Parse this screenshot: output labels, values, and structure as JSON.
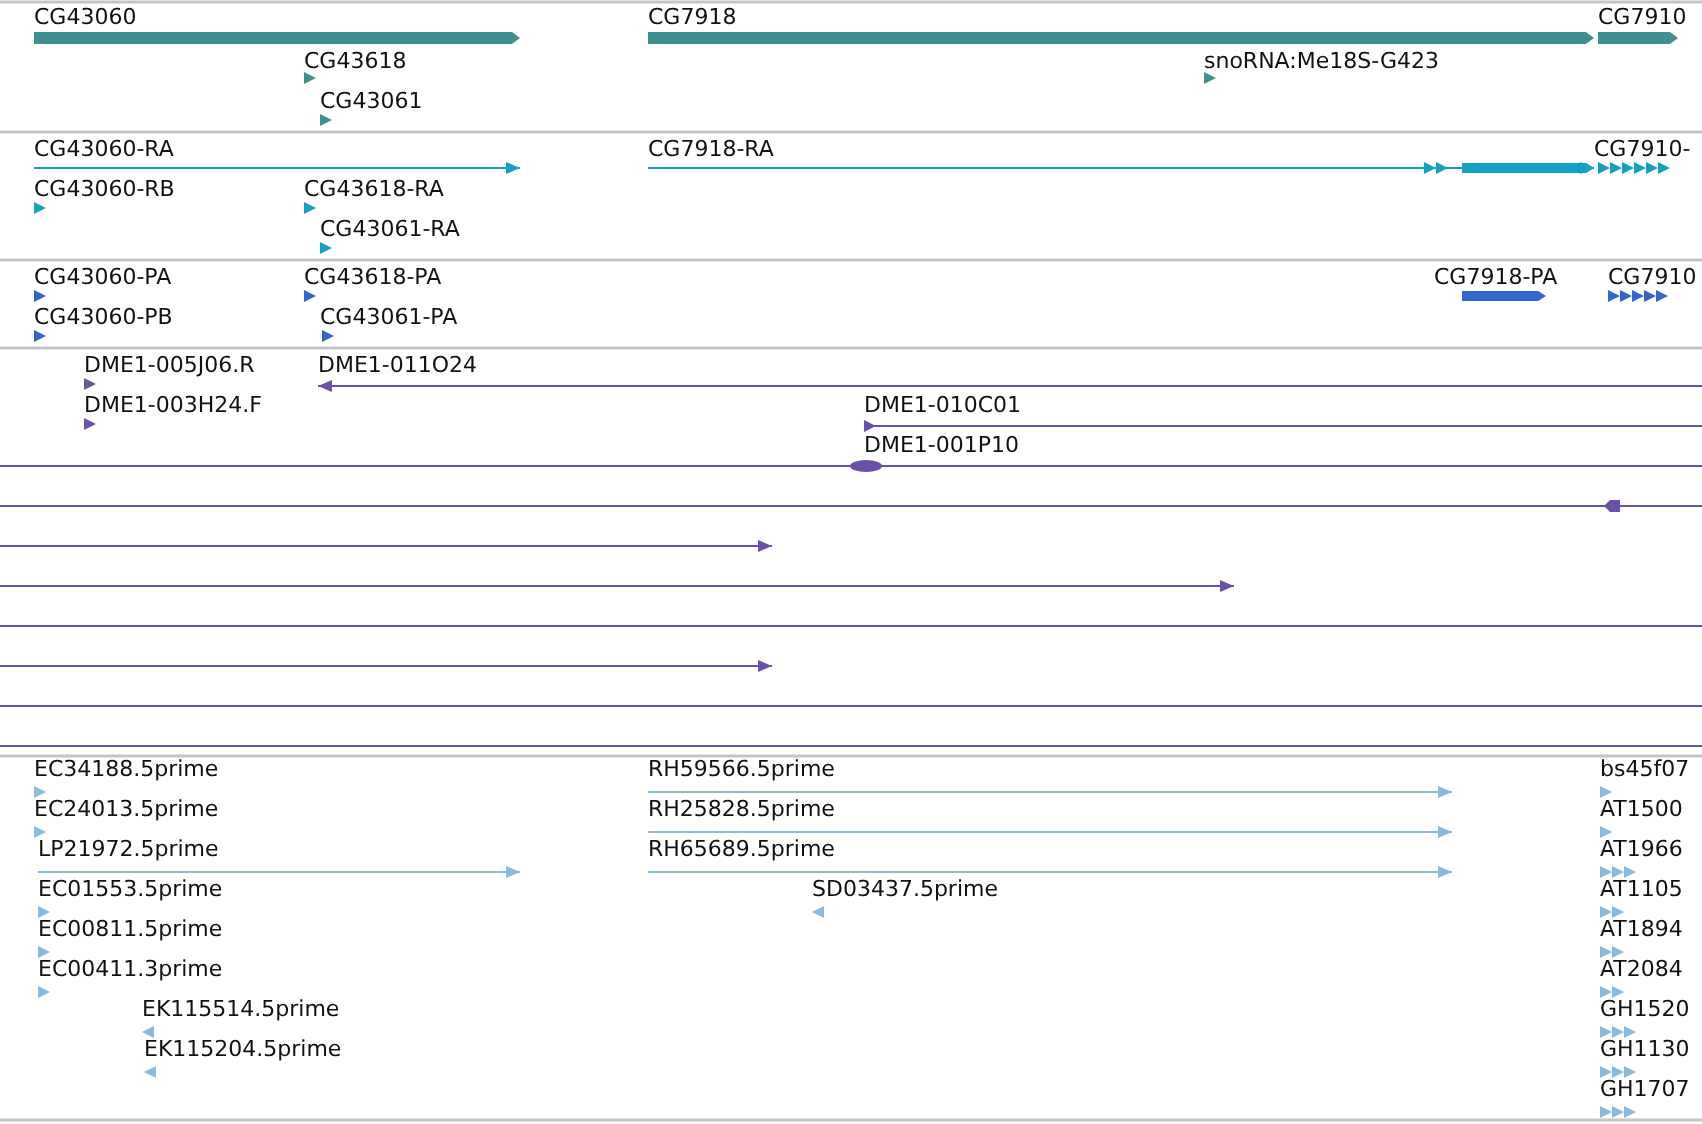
{
  "tracks": [
    {
      "color": "#3f9090",
      "features": [
        {
          "label": "CG43060",
          "kind": "block",
          "reverse": false
        },
        {
          "label": "CG43618",
          "kind": "arrow",
          "reverse": false
        },
        {
          "label": "CG43061",
          "kind": "arrow",
          "reverse": false
        },
        {
          "label": "CG7918",
          "kind": "block",
          "reverse": false
        },
        {
          "label": "snoRNA:Me18S-G423",
          "kind": "arrow",
          "reverse": false
        },
        {
          "label": "CG7910",
          "kind": "block",
          "reverse": false
        }
      ]
    },
    {
      "color": "#14a0c0",
      "features": [
        {
          "label": "CG43060-RA",
          "kind": "line",
          "reverse": false
        },
        {
          "label": "CG43060-RB",
          "kind": "arrow",
          "reverse": false
        },
        {
          "label": "CG43618-RA",
          "kind": "arrow",
          "reverse": false
        },
        {
          "label": "CG43061-RA",
          "kind": "arrow",
          "reverse": false
        },
        {
          "label": "CG7918-RA",
          "kind": "line",
          "reverse": false
        },
        {
          "label": "CG7910-",
          "kind": "arrow",
          "reverse": false
        }
      ]
    },
    {
      "color": "#3366cc",
      "features": [
        {
          "label": "CG43060-PA",
          "kind": "arrow",
          "reverse": false
        },
        {
          "label": "CG43060-PB",
          "kind": "arrow",
          "reverse": false
        },
        {
          "label": "CG43618-PA",
          "kind": "arrow",
          "reverse": false
        },
        {
          "label": "CG43061-PA",
          "kind": "arrow",
          "reverse": false
        },
        {
          "label": "CG7918-PA",
          "kind": "block",
          "reverse": false
        },
        {
          "label": "CG7910",
          "kind": "arrow",
          "reverse": false
        }
      ]
    },
    {
      "color": "#6a50aa",
      "features": [
        {
          "label": "DME1-005J06.R",
          "kind": "arrow",
          "reverse": false
        },
        {
          "label": "DME1-011O24",
          "kind": "line",
          "reverse": true
        },
        {
          "label": "DME1-003H24.F",
          "kind": "arrow",
          "reverse": false
        },
        {
          "label": "DME1-010C01",
          "kind": "line",
          "reverse": false
        },
        {
          "label": "DME1-001P10",
          "kind": "line"
        },
        {
          "kind": "line",
          "reverse": true
        },
        {
          "kind": "line",
          "reverse": false
        },
        {
          "kind": "line",
          "reverse": false
        },
        {
          "kind": "line"
        },
        {
          "kind": "line",
          "reverse": false
        },
        {
          "kind": "line"
        },
        {
          "kind": "line"
        }
      ]
    },
    {
      "color": "#88bbdd",
      "features": [
        {
          "label": "EC34188.5prime",
          "kind": "arrow",
          "reverse": false
        },
        {
          "label": "EC24013.5prime",
          "kind": "arrow",
          "reverse": false
        },
        {
          "label": "LP21972.5prime",
          "kind": "line",
          "reverse": false
        },
        {
          "label": "EC01553.5prime",
          "kind": "arrow",
          "reverse": false
        },
        {
          "label": "EC00811.5prime",
          "kind": "arrow",
          "reverse": false
        },
        {
          "label": "EC00411.3prime",
          "kind": "arrow",
          "reverse": false
        },
        {
          "label": "EK115514.5prime",
          "kind": "arrow",
          "reverse": true
        },
        {
          "label": "EK115204.5prime",
          "kind": "arrow",
          "reverse": true
        },
        {
          "label": "RH59566.5prime",
          "kind": "line",
          "reverse": false
        },
        {
          "label": "RH25828.5prime",
          "kind": "line",
          "reverse": false
        },
        {
          "label": "RH65689.5prime",
          "kind": "line",
          "reverse": false
        },
        {
          "label": "SD03437.5prime",
          "kind": "arrow",
          "reverse": true
        },
        {
          "label": "bs45f07",
          "kind": "arrow",
          "reverse": false
        },
        {
          "label": "AT1500",
          "kind": "arrow",
          "reverse": false
        },
        {
          "label": "AT1966",
          "kind": "arrow",
          "reverse": false
        },
        {
          "label": "AT1105",
          "kind": "arrow",
          "reverse": false
        },
        {
          "label": "AT1894",
          "kind": "arrow",
          "reverse": false
        },
        {
          "label": "AT2084",
          "kind": "arrow",
          "reverse": false
        },
        {
          "label": "GH1520",
          "kind": "arrow",
          "reverse": false
        },
        {
          "label": "GH1130",
          "kind": "arrow",
          "reverse": false
        },
        {
          "label": "GH1707",
          "kind": "arrow",
          "reverse": false
        }
      ]
    }
  ]
}
